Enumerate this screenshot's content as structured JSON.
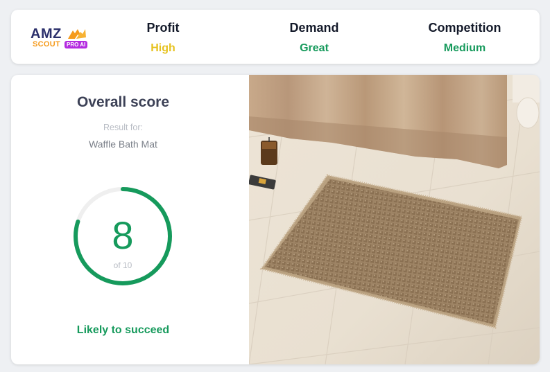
{
  "brand": {
    "logo_main": "AMZ",
    "logo_sub": "SCOUT",
    "logo_badge": "PRO AI"
  },
  "metrics": [
    {
      "label": "Profit",
      "value": "High",
      "color": "#e6c21f"
    },
    {
      "label": "Demand",
      "value": "Great",
      "color": "#169a5c"
    },
    {
      "label": "Competition",
      "value": "Medium",
      "color": "#169a5c"
    }
  ],
  "score_panel": {
    "title": "Overall score",
    "result_for_label": "Result for:",
    "product_name": "Waffle Bath Mat",
    "score": "8",
    "score_max_label": "of 10",
    "score_fraction": 0.8,
    "verdict": "Likely to succeed",
    "accent_color": "#169a5c"
  },
  "product_image": {
    "subject": "waffle bath mat photo"
  }
}
